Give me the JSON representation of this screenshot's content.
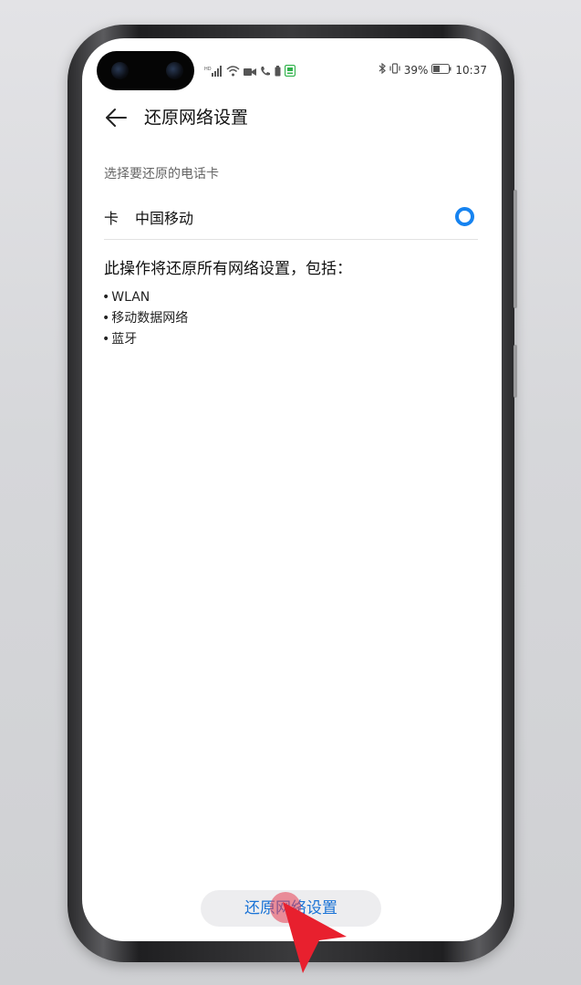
{
  "status_bar": {
    "battery_percent": "39%",
    "time": "10:37",
    "icons_left": [
      "hd-signal-icon",
      "wifi-icon",
      "video-call-icon",
      "phone-call-icon",
      "battery-small-icon",
      "app-notification-icon"
    ],
    "icons_right": [
      "bluetooth-icon",
      "vibrate-icon",
      "battery-icon"
    ]
  },
  "header": {
    "title": "还原网络设置"
  },
  "sim_section": {
    "label": "选择要还原的电话卡",
    "card_label": "卡",
    "card_name": "中国移动",
    "selected": true
  },
  "description": "此操作将还原所有网络设置，包括：",
  "bullets": [
    "WLAN",
    "移动数据网络",
    "蓝牙"
  ],
  "reset_button": {
    "label": "还原网络设置"
  },
  "colors": {
    "accent": "#1683f0",
    "button_text": "#1a73d6",
    "pointer": "#e8202e"
  }
}
